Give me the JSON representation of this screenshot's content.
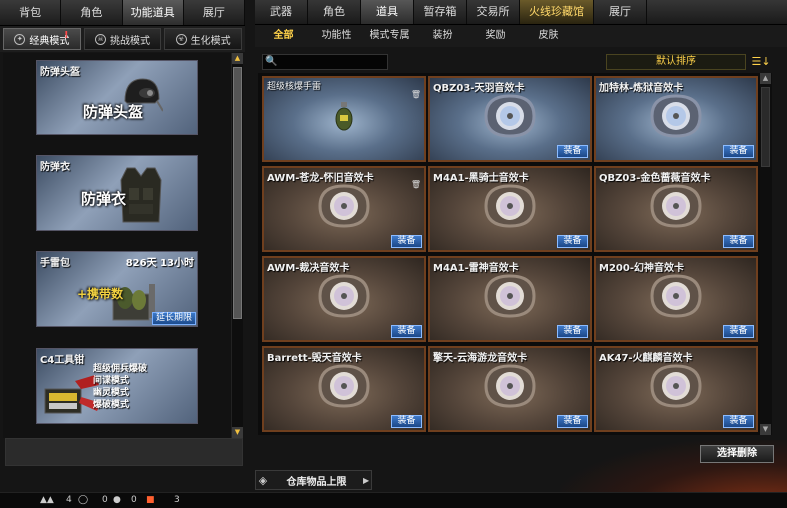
{
  "left_panel": {
    "tabs": [
      "背包",
      "角色",
      "功能道具",
      "展厅"
    ],
    "active_tab": 2,
    "modes": [
      {
        "label": "经典模式",
        "icon": "bullet-icon"
      },
      {
        "label": "挑战模式",
        "icon": "skull-icon"
      },
      {
        "label": "生化模式",
        "icon": "biohazard-icon"
      }
    ],
    "mode_alert": "!",
    "items": [
      {
        "title": "防弹头盔",
        "big_label": "防弹头盔",
        "icon": "helmet-icon"
      },
      {
        "title": "防弹衣",
        "big_label": "防弹衣",
        "icon": "vest-icon"
      },
      {
        "title": "手雷包",
        "count": "826天 13小时",
        "big_label": "+携带数",
        "button": "延长期限",
        "icon": "grenade-pack-icon"
      },
      {
        "title": "C4工具钳",
        "modes": [
          "超级佣兵爆破",
          "间谍模式",
          "幽灵模式",
          "爆破模式"
        ],
        "icon": "pliers-icon"
      }
    ]
  },
  "right_panel": {
    "tabs": [
      "武器",
      "角色",
      "道具",
      "暂存箱",
      "交易所",
      "火线珍藏馆",
      "展厅"
    ],
    "active_tab": 2,
    "sub_tabs": [
      "全部",
      "功能性",
      "模式专属",
      "装扮",
      "奖励",
      "皮肤"
    ],
    "active_sub_tab": 0,
    "search": {
      "value": "",
      "icon": "search-icon"
    },
    "sort_label": "默认排序",
    "cards": [
      {
        "title": "超级核爆手雷",
        "style": "blue",
        "equip": ""
      },
      {
        "title": "QBZ03-天羽音效卡",
        "style": "blue",
        "equip": "装备"
      },
      {
        "title": "加特林-炼狱音效卡",
        "style": "blue",
        "equip": "装备"
      },
      {
        "title": "AWM-苍龙-怀旧音效卡",
        "style": "brown",
        "equip": "装备"
      },
      {
        "title": "M4A1-黑骑士音效卡",
        "style": "brown",
        "equip": "装备"
      },
      {
        "title": "QBZ03-金色蔷薇音效卡",
        "style": "brown",
        "equip": "装备"
      },
      {
        "title": "AWM-裁决音效卡",
        "style": "brown",
        "equip": "装备"
      },
      {
        "title": "M4A1-雷神音效卡",
        "style": "brown",
        "equip": "装备"
      },
      {
        "title": "M200-幻神音效卡",
        "style": "brown",
        "equip": "装备"
      },
      {
        "title": "Barrett-毁天音效卡",
        "style": "brown",
        "equip": "装备"
      },
      {
        "title": "擎天-云海游龙音效卡",
        "style": "brown",
        "equip": "装备"
      },
      {
        "title": "AK47-火麒麟音效卡",
        "style": "brown",
        "equip": "装备"
      }
    ],
    "select_delete": "选择删除",
    "warehouse_limit": "仓库物品上限"
  },
  "status_bar": {
    "values": [
      "4",
      "0",
      "0",
      "3"
    ],
    "icons": [
      "grenade-icon",
      "shield-icon",
      "chat-icon",
      "gift-icon"
    ]
  }
}
